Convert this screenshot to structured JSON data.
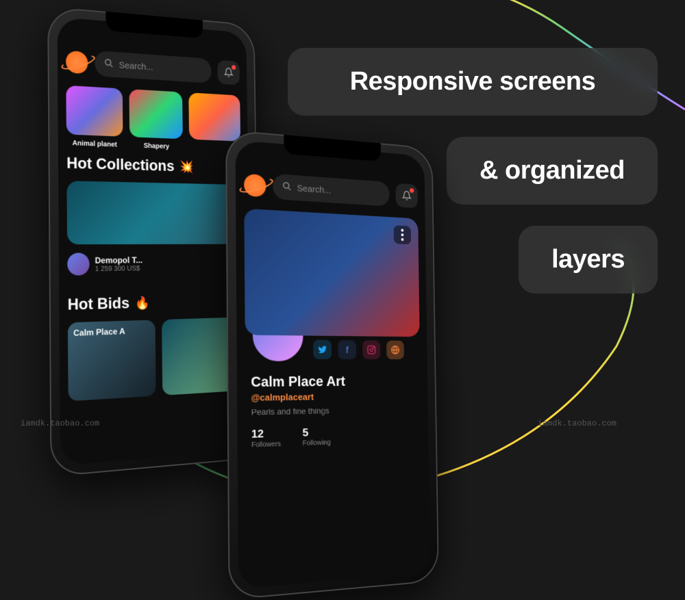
{
  "badges": {
    "b1": "Responsive screens",
    "b2": "& organized",
    "b3": "layers"
  },
  "app": {
    "search_placeholder": "Search...",
    "categories": [
      {
        "label": "Animal planet"
      },
      {
        "label": "Shapery"
      }
    ],
    "sections": {
      "hot_collections": "Hot Collections",
      "hot_bids": "Hot Bids"
    },
    "collection": {
      "name": "Demopol T...",
      "price": "1 259 300 US$"
    },
    "bids": {
      "card1": "Calm Place A"
    },
    "profile": {
      "name": "Calm Place Art",
      "handle": "@calmplaceart",
      "bio": "Pearls and fine things",
      "stats": [
        {
          "num": "12",
          "label": "Followers"
        },
        {
          "num": "5",
          "label": "Following"
        }
      ]
    }
  },
  "watermarks": {
    "left": "iamdk.taobao.com",
    "right": "iamdk.taobao.com"
  }
}
